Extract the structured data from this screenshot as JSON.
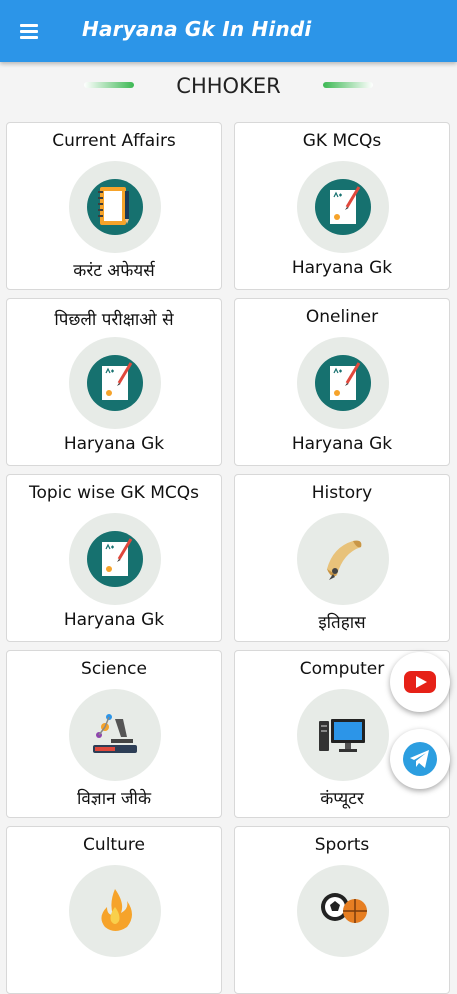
{
  "appbar": {
    "title": "Haryana Gk In Hindi",
    "color": "#2c95e8"
  },
  "brand": {
    "name": "CHHOKER"
  },
  "cards": [
    {
      "title": "Current Affairs",
      "subtitle": "करंट अफेयर्स",
      "icon": "notebook-icon"
    },
    {
      "title": "GK MCQs",
      "subtitle": "Haryana Gk",
      "icon": "quiz-paper-icon"
    },
    {
      "title": "पिछली परीक्षाओ से",
      "subtitle": "Haryana Gk",
      "icon": "quiz-paper-icon"
    },
    {
      "title": "Oneliner",
      "subtitle": "Haryana Gk",
      "icon": "quiz-paper-icon"
    },
    {
      "title": "Topic wise GK MCQs",
      "subtitle": "Haryana Gk",
      "icon": "quiz-paper-icon"
    },
    {
      "title": "History",
      "subtitle": "इतिहास",
      "icon": "scroll-icon"
    },
    {
      "title": "Science",
      "subtitle": "विज्ञान जीके",
      "icon": "microscope-icon"
    },
    {
      "title": "Computer",
      "subtitle": "कंप्यूटर",
      "icon": "computer-icon"
    },
    {
      "title": "Culture",
      "subtitle": "",
      "icon": "flame-icon"
    },
    {
      "title": "Sports",
      "subtitle": "",
      "icon": "ball-icon"
    }
  ],
  "fabs": {
    "youtube": "youtube-icon",
    "telegram": "telegram-icon"
  }
}
